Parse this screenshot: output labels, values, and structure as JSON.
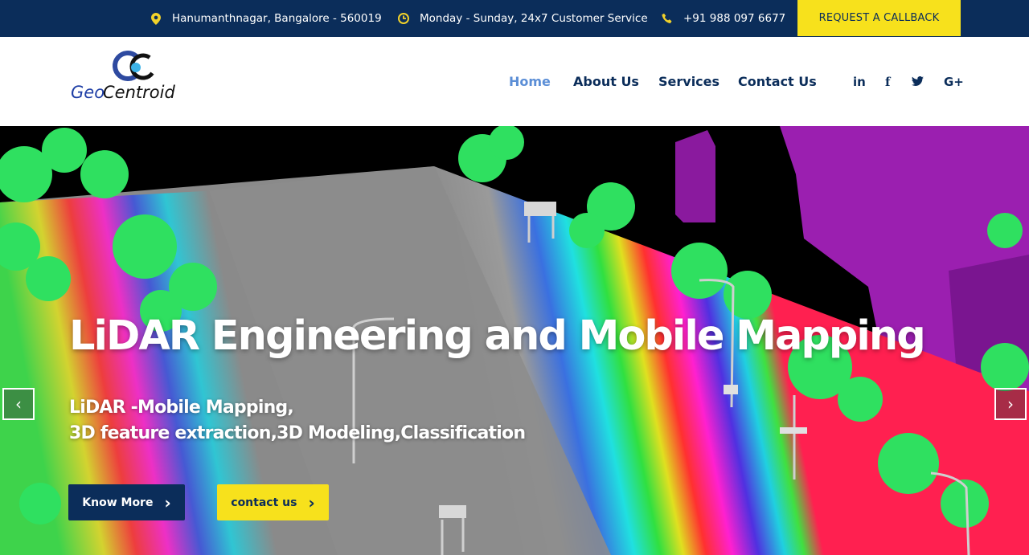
{
  "topbar": {
    "address": "Hanumanthnagar, Bangalore - 560019",
    "hours": "Monday - Sunday, 24x7 Customer Service",
    "phone": "+91 988 097 6677",
    "callback_label": "REQUEST A CALLBACK",
    "icons": [
      "map-pin-icon",
      "clock-icon",
      "phone-icon"
    ]
  },
  "logo": {
    "part1": "Geo",
    "part2": "Centroid",
    "monogram": "GC"
  },
  "nav": {
    "items": [
      {
        "label": "Home",
        "active": true
      },
      {
        "label": "About Us",
        "active": false
      },
      {
        "label": "Services",
        "active": false
      },
      {
        "label": "Contact Us",
        "active": false
      }
    ]
  },
  "social": {
    "linkedin": "in",
    "facebook": "f",
    "twitter": "t",
    "googleplus": "G+"
  },
  "hero": {
    "title": "LiDAR Engineering and Mobile Mapping",
    "subtitle_line1": "LiDAR -Mobile Mapping,",
    "subtitle_line2": "3D feature extraction,3D Modeling,Classification",
    "know_more": "Know More",
    "contact_us": "contact us",
    "chevron": "›",
    "prev": "‹",
    "next": "›"
  },
  "colors": {
    "navy": "#0b2d5a",
    "yellow": "#f7e11c",
    "nav_active": "#5b8ed6",
    "icon_yellow": "#f2d22a"
  }
}
